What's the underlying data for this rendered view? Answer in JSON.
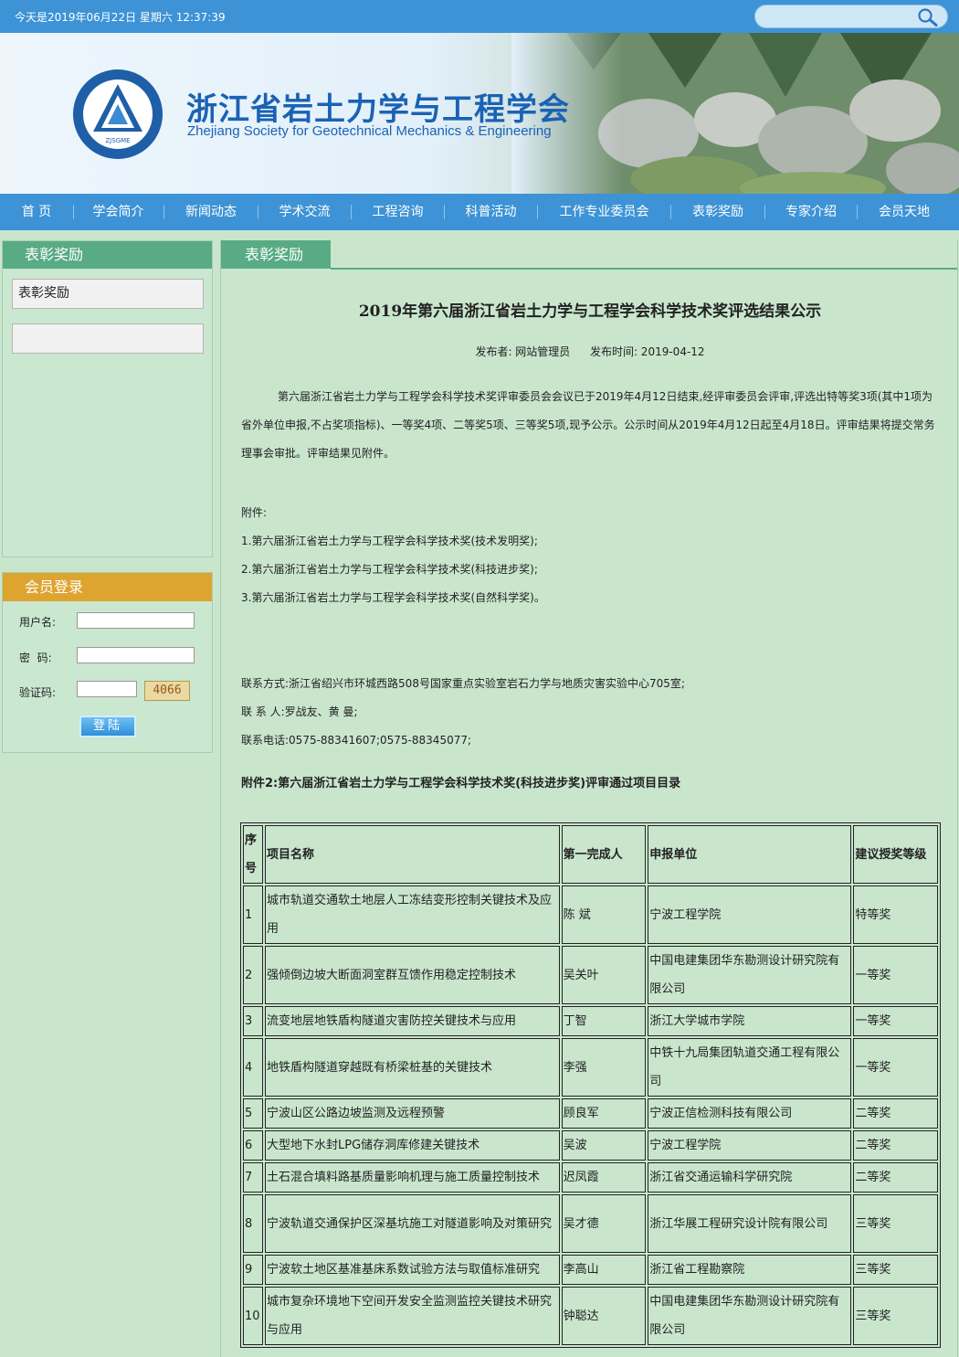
{
  "topbar": {
    "date_text": "今天是2019年06月22日 星期六 12:37:39",
    "search_placeholder": ""
  },
  "header": {
    "title_cn": "浙江省岩土力学与工程学会",
    "title_en": "Zhejiang Society for Geotechnical Mechanics & Engineering",
    "logo_abbr": "ZJSGME"
  },
  "nav": {
    "items": [
      "首 页",
      "学会简介",
      "新闻动态",
      "学术交流",
      "工程咨询",
      "科普活动",
      "工作专业委员会",
      "表彰奖励",
      "专家介绍",
      "会员天地"
    ]
  },
  "sidebar": {
    "heading": "表彰奖励",
    "items": [
      "表彰奖励",
      ""
    ]
  },
  "login": {
    "heading": "会员登录",
    "username_label": "用户名:",
    "password_label": "密  码:",
    "captcha_label": "验证码:",
    "captcha_code": "4066",
    "submit_label": "登陆"
  },
  "main": {
    "tab": "表彰奖励",
    "title": "2019年第六届浙江省岩土力学与工程学会科学技术奖评选结果公示",
    "publisher": "发布者: 网站管理员",
    "publish_time": "发布时间: 2019-04-12",
    "intro": "第六届浙江省岩土力学与工程学会科学技术奖评审委员会会议已于2019年4月12日结束,经评审委员会评审,评选出特等奖3项(其中1项为省外单位申报,不占奖项指标)、一等奖4项、二等奖5项、三等奖5项,现予公示。公示时间从2019年4月12日起至4月18日。评审结果将提交常务理事会审批。评审结果见附件。",
    "attachments_label": "附件:",
    "attachments": [
      "1.第六届浙江省岩土力学与工程学会科学技术奖(技术发明奖);",
      "2.第六届浙江省岩土力学与工程学会科学技术奖(科技进步奖);",
      "3.第六届浙江省岩土力学与工程学会科学技术奖(自然科学奖)。"
    ],
    "contact": "联系方式:浙江省绍兴市环城西路508号国家重点实验室岩石力学与地质灾害实验中心705室;",
    "contact_people": "联 系 人:罗战友、黄 曼;",
    "contact_phone": "联系电话:0575-88341607;0575-88345077;",
    "table_title": "附件2:第六届浙江省岩土力学与工程学会科学技术奖(科技进步奖)评审通过项目目录",
    "table": {
      "headers": [
        "序号",
        "项目名称",
        "第一完成人",
        "申报单位",
        "建议授奖等级"
      ],
      "rows": [
        [
          "1",
          "城市轨道交通软土地层人工冻结变形控制关键技术及应用",
          "陈 斌",
          "宁波工程学院",
          "特等奖"
        ],
        [
          "2",
          "强倾倒边坡大断面洞室群互馈作用稳定控制技术",
          "吴关叶",
          "中国电建集团华东勘测设计研究院有限公司",
          "一等奖"
        ],
        [
          "3",
          "流变地层地铁盾构隧道灾害防控关键技术与应用",
          "丁智",
          "浙江大学城市学院",
          "一等奖"
        ],
        [
          "4",
          "地铁盾构隧道穿越既有桥梁桩基的关键技术",
          "李强",
          "中铁十九局集团轨道交通工程有限公司",
          "一等奖"
        ],
        [
          "5",
          "宁波山区公路边坡监测及远程预警",
          "顾良军",
          "宁波正信检测科技有限公司",
          "二等奖"
        ],
        [
          "6",
          "大型地下水封LPG储存洞库修建关键技术",
          "吴波",
          "宁波工程学院",
          "二等奖"
        ],
        [
          "7",
          "土石混合填料路基质量影响机理与施工质量控制技术",
          "迟凤霞",
          "浙江省交通运输科学研究院",
          "二等奖"
        ],
        [
          "8",
          "宁波轨道交通保护区深基坑施工对隧道影响及对策研究",
          "吴才德",
          "浙江华展工程研究设计院有限公司",
          "三等奖"
        ],
        [
          "9",
          "宁波软土地区基准基床系数试验方法与取值标准研究",
          "李高山",
          "浙江省工程勘察院",
          "三等奖"
        ],
        [
          "10",
          "城市复杂环境地下空间开发安全监测监控关键技术研究与应用",
          "钟聪达",
          "中国电建集团华东勘测设计研究院有限公司",
          "三等奖"
        ]
      ]
    }
  },
  "colors": {
    "nav_blue": "#3d93d6",
    "header_green": "#58ab85",
    "login_orange": "#dea430",
    "page_green": "#c9e6cd",
    "title_blue": "#1a62b4"
  }
}
